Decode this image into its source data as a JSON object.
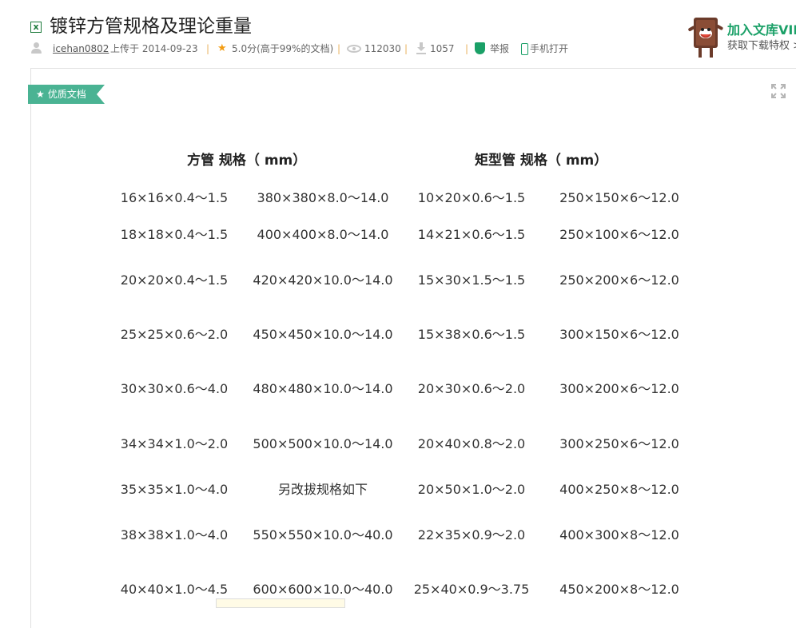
{
  "document": {
    "title": "镀锌方管规格及理论重量",
    "type_icon": "excel-file-icon"
  },
  "meta": {
    "author": "icehan0802",
    "uploaded_label": "上传于",
    "upload_date": "2014-09-23",
    "separator": "|",
    "rating": "5.0分(高于99%的文档)",
    "views": "112030",
    "downloads": "1057",
    "report_label": "举报",
    "phone_label": "手机打开"
  },
  "vip": {
    "title": "加入文库VIP",
    "subtitle": "获取下载特权 >"
  },
  "badge": {
    "label": "优质文档"
  },
  "table": {
    "square_header": "方管  规格（  mm）",
    "rect_header": "矩型管  规格（  mm）",
    "rows": [
      [
        "16×16×0.4～1.5",
        "380×380×8.0～14.0",
        "10×20×0.6～1.5",
        "250×150×6～12.0"
      ],
      [
        "18×18×0.4～1.5",
        "400×400×8.0～14.0",
        "14×21×0.6～1.5",
        "250×100×6～12.0"
      ],
      [
        "20×20×0.4～1.5",
        "420×420×10.0～14.0",
        "15×30×1.5～1.5",
        "250×200×6～12.0"
      ],
      [
        "25×25×0.6～2.0",
        "450×450×10.0～14.0",
        "15×38×0.6～1.5",
        "300×150×6～12.0"
      ],
      [
        "30×30×0.6～4.0",
        "480×480×10.0～14.0",
        "20×30×0.6～2.0",
        "300×200×6～12.0"
      ],
      [
        "34×34×1.0～2.0",
        "500×500×10.0～14.0",
        "20×40×0.8～2.0",
        "300×250×6～12.0"
      ],
      [
        "35×35×1.0～4.0",
        "另改拔规格如下",
        "20×50×1.0～2.0",
        "400×250×8～12.0"
      ],
      [
        "38×38×1.0～4.0",
        "550×550×10.0～40.0",
        "22×35×0.9～2.0",
        "400×300×8～12.0"
      ],
      [
        "40×40×1.0～4.5",
        "600×600×10.0～40.0",
        "25×40×0.9～3.75",
        "450×200×8～12.0"
      ]
    ]
  }
}
